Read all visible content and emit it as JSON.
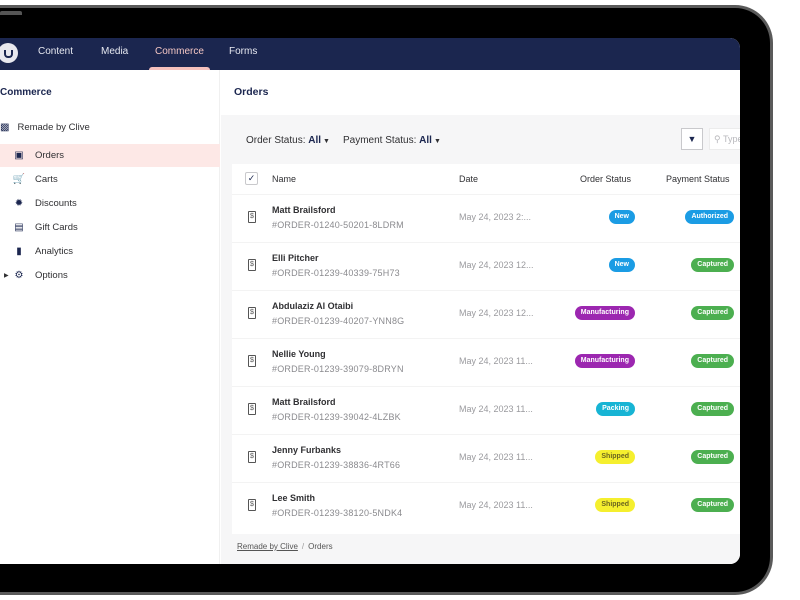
{
  "nav": {
    "items": [
      {
        "label": "Content",
        "active": false
      },
      {
        "label": "Media",
        "active": false
      },
      {
        "label": "Commerce",
        "active": true
      },
      {
        "label": "Forms",
        "active": false
      }
    ]
  },
  "sidebar": {
    "section_title": "Commerce",
    "store": {
      "label": "Remade by Clive",
      "icon": "store-icon"
    },
    "items": [
      {
        "label": "Orders",
        "icon": "inbox-icon",
        "active": true
      },
      {
        "label": "Carts",
        "icon": "cart-icon",
        "active": false
      },
      {
        "label": "Discounts",
        "icon": "discount-icon",
        "active": false
      },
      {
        "label": "Gift Cards",
        "icon": "gift-card-icon",
        "active": false
      },
      {
        "label": "Analytics",
        "icon": "chart-icon",
        "active": false
      },
      {
        "label": "Options",
        "icon": "gear-icon",
        "active": false,
        "expandable": true
      }
    ]
  },
  "main": {
    "title": "Orders",
    "filters": {
      "order_status_label": "Order Status:",
      "order_status_value": "All",
      "payment_status_label": "Payment Status:",
      "payment_status_value": "All"
    },
    "search_placeholder": "Type",
    "columns": [
      "Name",
      "Date",
      "Order Status",
      "Payment Status"
    ],
    "rows": [
      {
        "name": "Matt Brailsford",
        "order": "#ORDER-01240-50201-8LDRM",
        "date": "May 24, 2023 2:...",
        "order_status": "New",
        "payment_status": "Authorized"
      },
      {
        "name": "Elli Pitcher",
        "order": "#ORDER-01239-40339-75H73",
        "date": "May 24, 2023 12...",
        "order_status": "New",
        "payment_status": "Captured"
      },
      {
        "name": "Abdulaziz Al Otaibi",
        "order": "#ORDER-01239-40207-YNN8G",
        "date": "May 24, 2023 12...",
        "order_status": "Manufacturing",
        "payment_status": "Captured"
      },
      {
        "name": "Nellie Young",
        "order": "#ORDER-01239-39079-8DRYN",
        "date": "May 24, 2023 11...",
        "order_status": "Manufacturing",
        "payment_status": "Captured"
      },
      {
        "name": "Matt Brailsford",
        "order": "#ORDER-01239-39042-4LZBK",
        "date": "May 24, 2023 11...",
        "order_status": "Packing",
        "payment_status": "Captured"
      },
      {
        "name": "Jenny Furbanks",
        "order": "#ORDER-01239-38836-4RT66",
        "date": "May 24, 2023 11...",
        "order_status": "Shipped",
        "payment_status": "Captured"
      },
      {
        "name": "Lee Smith",
        "order": "#ORDER-01239-38120-5NDK4",
        "date": "May 24, 2023 11...",
        "order_status": "Shipped",
        "payment_status": "Captured"
      }
    ],
    "status_colors": {
      "New": {
        "bg": "#1b9ce4",
        "fg": "#ffffff"
      },
      "Manufacturing": {
        "bg": "#9c27b0",
        "fg": "#ffffff"
      },
      "Packing": {
        "bg": "#17b4d4",
        "fg": "#ffffff"
      },
      "Shipped": {
        "bg": "#f5ef2e",
        "fg": "#6b6520"
      },
      "Authorized": {
        "bg": "#1b9ce4",
        "fg": "#ffffff"
      },
      "Captured": {
        "bg": "#4caf50",
        "fg": "#ffffff"
      }
    }
  },
  "breadcrumb": {
    "items": [
      "Remade by Clive",
      "Orders"
    ],
    "separator": "/"
  }
}
